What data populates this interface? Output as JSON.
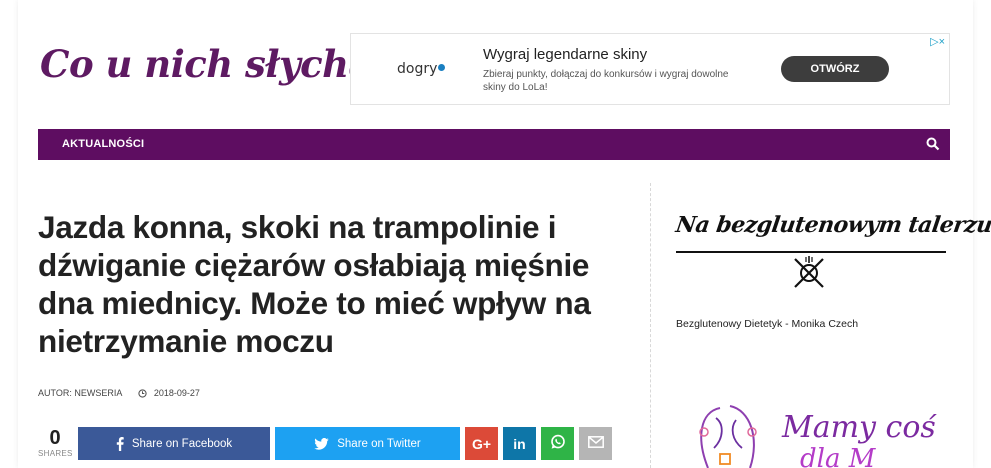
{
  "site": {
    "logo_text": "Co u nich słychać?",
    "brand_color": "#5e0d61"
  },
  "ad": {
    "brand": "dogry",
    "title": "Wygraj legendarne skiny",
    "text": "Zbieraj punkty, dołączaj do konkursów i wygraj dowolne skiny do LoLa!",
    "cta": "OTWÓRZ",
    "badge": "▷×"
  },
  "nav": {
    "items": [
      {
        "label": "AKTUALNOŚCI"
      }
    ],
    "search_icon": "search-icon"
  },
  "article": {
    "title": "Jazda konna, skoki na trampolinie i dźwiganie ciężarów osłabiają mięśnie dna miednicy. Może to mieć wpływ na nietrzymanie moczu",
    "author_label": "AUTOR: NEWSERIA",
    "date": "2018-09-27"
  },
  "share": {
    "count": "0",
    "count_label": "SHARES",
    "facebook": "Share on Facebook",
    "twitter": "Share on Twitter",
    "googleplus": "G+",
    "linkedin": "in",
    "colors": {
      "facebook": "#3b5998",
      "twitter": "#1da1f2",
      "googleplus": "#dc4a38",
      "linkedin": "#0e76a8",
      "whatsapp": "#2fb447",
      "email": "#b5b5b5"
    }
  },
  "sidebar": {
    "widget1": {
      "brand": "Na bezglutenowym talerzu",
      "caption": "Bezglutenowy Dietetyk - Monika Czech"
    },
    "widget2": {
      "title": "Mamy coś",
      "subtitle": "dla M"
    }
  }
}
